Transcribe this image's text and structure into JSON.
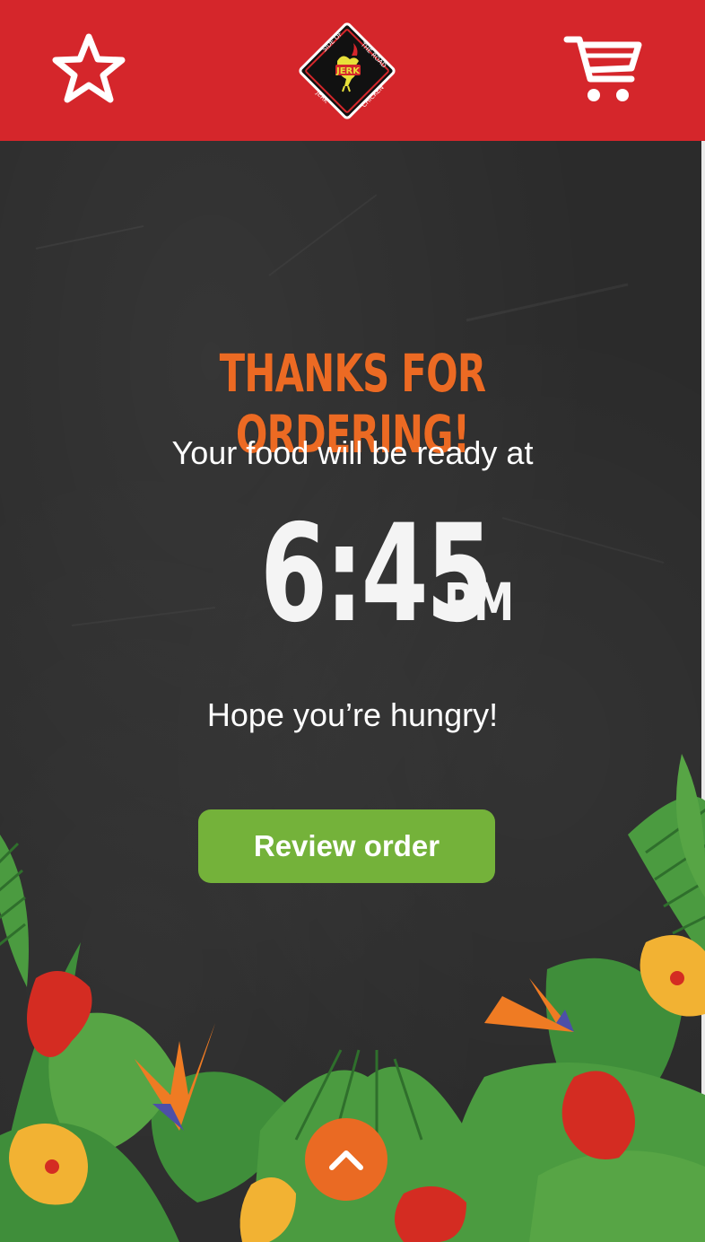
{
  "header": {
    "favorites_icon": "star-icon",
    "cart_icon": "cart-icon",
    "logo_text": {
      "top_left": "SIDE OF",
      "top_right": "THE ROAD",
      "bottom_left": "JERK",
      "bottom_right": "CHICKEN",
      "badge": "JERK"
    },
    "color": "#d5262b"
  },
  "confirmation": {
    "title": "THANKS FOR ORDERING!",
    "ready_text": "Your food will be ready at",
    "time": "6:45",
    "ampm": "PM",
    "closing_text": "Hope you’re hungry!",
    "review_button": "Review order"
  },
  "scroll_top_icon": "chevron-up-icon",
  "colors": {
    "accent_orange": "#ec6a23",
    "button_green": "#74b23a",
    "chalkboard": "#2b2b2b"
  }
}
